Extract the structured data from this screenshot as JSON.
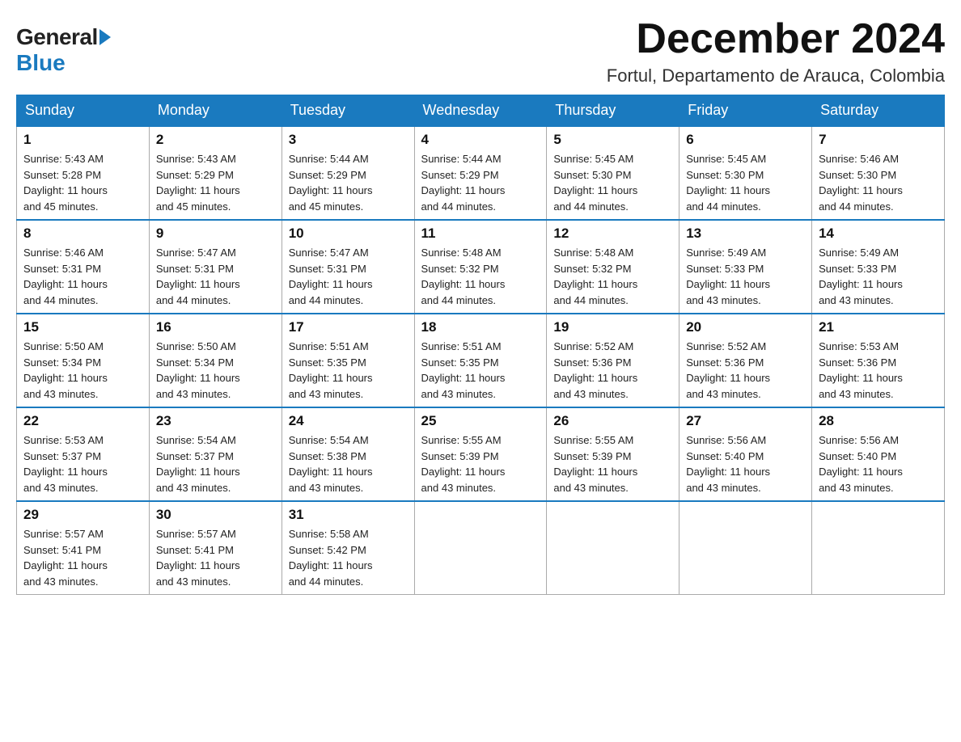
{
  "logo": {
    "general": "General",
    "blue": "Blue"
  },
  "header": {
    "month_title": "December 2024",
    "location": "Fortul, Departamento de Arauca, Colombia"
  },
  "weekdays": [
    "Sunday",
    "Monday",
    "Tuesday",
    "Wednesday",
    "Thursday",
    "Friday",
    "Saturday"
  ],
  "weeks": [
    [
      {
        "day": "1",
        "sunrise": "5:43 AM",
        "sunset": "5:28 PM",
        "daylight": "11 hours and 45 minutes."
      },
      {
        "day": "2",
        "sunrise": "5:43 AM",
        "sunset": "5:29 PM",
        "daylight": "11 hours and 45 minutes."
      },
      {
        "day": "3",
        "sunrise": "5:44 AM",
        "sunset": "5:29 PM",
        "daylight": "11 hours and 45 minutes."
      },
      {
        "day": "4",
        "sunrise": "5:44 AM",
        "sunset": "5:29 PM",
        "daylight": "11 hours and 44 minutes."
      },
      {
        "day": "5",
        "sunrise": "5:45 AM",
        "sunset": "5:30 PM",
        "daylight": "11 hours and 44 minutes."
      },
      {
        "day": "6",
        "sunrise": "5:45 AM",
        "sunset": "5:30 PM",
        "daylight": "11 hours and 44 minutes."
      },
      {
        "day": "7",
        "sunrise": "5:46 AM",
        "sunset": "5:30 PM",
        "daylight": "11 hours and 44 minutes."
      }
    ],
    [
      {
        "day": "8",
        "sunrise": "5:46 AM",
        "sunset": "5:31 PM",
        "daylight": "11 hours and 44 minutes."
      },
      {
        "day": "9",
        "sunrise": "5:47 AM",
        "sunset": "5:31 PM",
        "daylight": "11 hours and 44 minutes."
      },
      {
        "day": "10",
        "sunrise": "5:47 AM",
        "sunset": "5:31 PM",
        "daylight": "11 hours and 44 minutes."
      },
      {
        "day": "11",
        "sunrise": "5:48 AM",
        "sunset": "5:32 PM",
        "daylight": "11 hours and 44 minutes."
      },
      {
        "day": "12",
        "sunrise": "5:48 AM",
        "sunset": "5:32 PM",
        "daylight": "11 hours and 44 minutes."
      },
      {
        "day": "13",
        "sunrise": "5:49 AM",
        "sunset": "5:33 PM",
        "daylight": "11 hours and 43 minutes."
      },
      {
        "day": "14",
        "sunrise": "5:49 AM",
        "sunset": "5:33 PM",
        "daylight": "11 hours and 43 minutes."
      }
    ],
    [
      {
        "day": "15",
        "sunrise": "5:50 AM",
        "sunset": "5:34 PM",
        "daylight": "11 hours and 43 minutes."
      },
      {
        "day": "16",
        "sunrise": "5:50 AM",
        "sunset": "5:34 PM",
        "daylight": "11 hours and 43 minutes."
      },
      {
        "day": "17",
        "sunrise": "5:51 AM",
        "sunset": "5:35 PM",
        "daylight": "11 hours and 43 minutes."
      },
      {
        "day": "18",
        "sunrise": "5:51 AM",
        "sunset": "5:35 PM",
        "daylight": "11 hours and 43 minutes."
      },
      {
        "day": "19",
        "sunrise": "5:52 AM",
        "sunset": "5:36 PM",
        "daylight": "11 hours and 43 minutes."
      },
      {
        "day": "20",
        "sunrise": "5:52 AM",
        "sunset": "5:36 PM",
        "daylight": "11 hours and 43 minutes."
      },
      {
        "day": "21",
        "sunrise": "5:53 AM",
        "sunset": "5:36 PM",
        "daylight": "11 hours and 43 minutes."
      }
    ],
    [
      {
        "day": "22",
        "sunrise": "5:53 AM",
        "sunset": "5:37 PM",
        "daylight": "11 hours and 43 minutes."
      },
      {
        "day": "23",
        "sunrise": "5:54 AM",
        "sunset": "5:37 PM",
        "daylight": "11 hours and 43 minutes."
      },
      {
        "day": "24",
        "sunrise": "5:54 AM",
        "sunset": "5:38 PM",
        "daylight": "11 hours and 43 minutes."
      },
      {
        "day": "25",
        "sunrise": "5:55 AM",
        "sunset": "5:39 PM",
        "daylight": "11 hours and 43 minutes."
      },
      {
        "day": "26",
        "sunrise": "5:55 AM",
        "sunset": "5:39 PM",
        "daylight": "11 hours and 43 minutes."
      },
      {
        "day": "27",
        "sunrise": "5:56 AM",
        "sunset": "5:40 PM",
        "daylight": "11 hours and 43 minutes."
      },
      {
        "day": "28",
        "sunrise": "5:56 AM",
        "sunset": "5:40 PM",
        "daylight": "11 hours and 43 minutes."
      }
    ],
    [
      {
        "day": "29",
        "sunrise": "5:57 AM",
        "sunset": "5:41 PM",
        "daylight": "11 hours and 43 minutes."
      },
      {
        "day": "30",
        "sunrise": "5:57 AM",
        "sunset": "5:41 PM",
        "daylight": "11 hours and 43 minutes."
      },
      {
        "day": "31",
        "sunrise": "5:58 AM",
        "sunset": "5:42 PM",
        "daylight": "11 hours and 44 minutes."
      },
      null,
      null,
      null,
      null
    ]
  ],
  "labels": {
    "sunrise": "Sunrise:",
    "sunset": "Sunset:",
    "daylight": "Daylight:"
  }
}
